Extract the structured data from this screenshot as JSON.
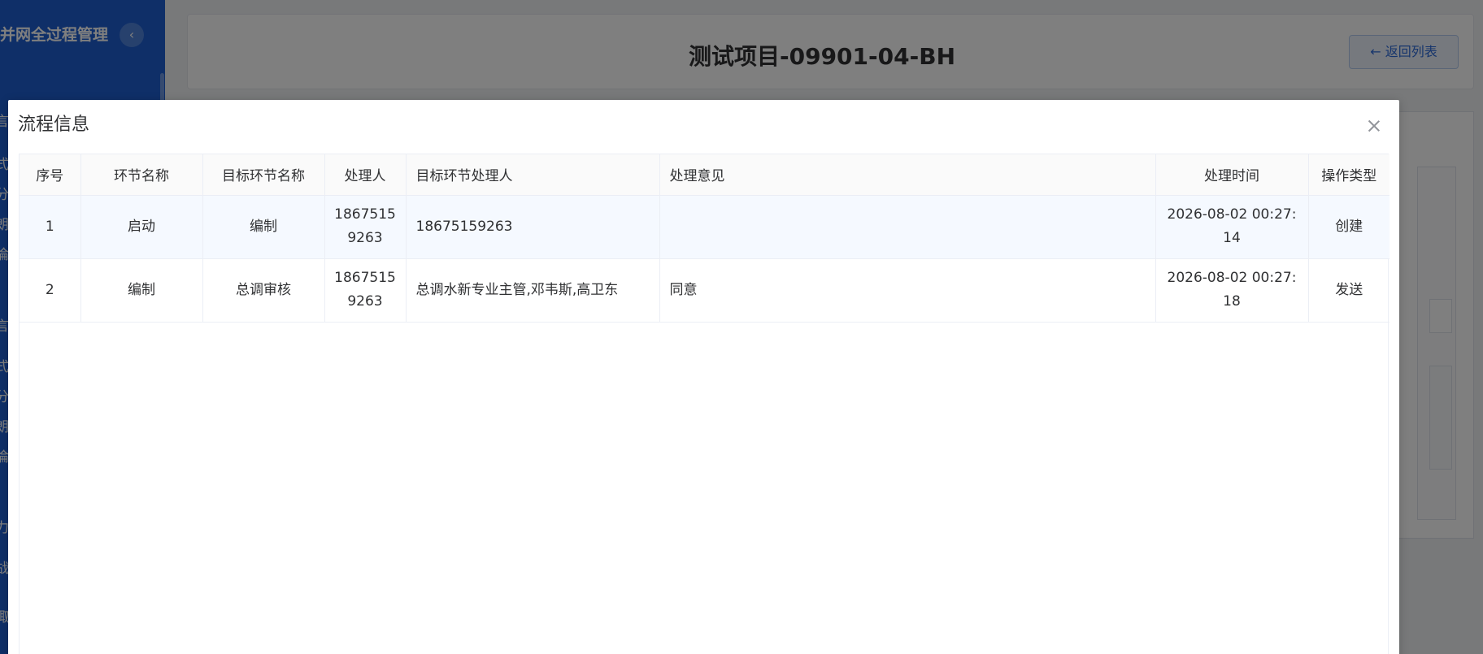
{
  "sidebar": {
    "title": "并网全过程管理",
    "collapse_glyph": "‹",
    "nav_fragments": [
      "言",
      "式",
      "分",
      "朗",
      "倫",
      "言",
      "式",
      "分",
      "朗",
      "倫",
      "力",
      "战",
      "陬"
    ]
  },
  "header": {
    "project_title": "测试项目-09901-04-BH",
    "back_label": "← 返回列表"
  },
  "dialog": {
    "title": "流程信息",
    "close_icon": "close-icon",
    "columns": [
      "序号",
      "环节名称",
      "目标环节名称",
      "处理人",
      "目标环节处理人",
      "处理意见",
      "处理时间",
      "操作类型"
    ],
    "rows": [
      {
        "index": "1",
        "step": "启动",
        "target_step": "编制",
        "handler": "18675159263",
        "target_handler": "18675159263",
        "opinion": "",
        "time": "2026-08-02 00:27:14",
        "op_type": "创建"
      },
      {
        "index": "2",
        "step": "编制",
        "target_step": "总调审核",
        "handler": "18675159263",
        "target_handler": "总调水新专业主管,邓韦斯,高卫东",
        "opinion": "同意",
        "time": "2026-08-02 00:27:18",
        "op_type": "发送"
      }
    ]
  },
  "colors": {
    "sidebar_bg": "#1e5fd1",
    "accent": "#2d6ad9",
    "overlay": "rgba(0,0,0,0.5)",
    "row_highlight": "#f5f9ff"
  }
}
